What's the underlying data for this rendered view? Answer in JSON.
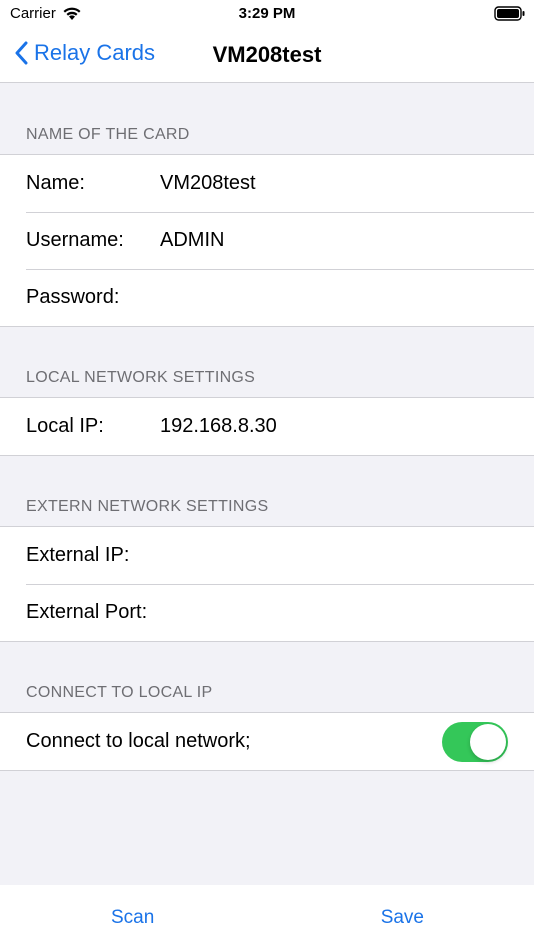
{
  "status_bar": {
    "carrier": "Carrier",
    "time": "3:29 PM"
  },
  "nav": {
    "back_label": "Relay Cards",
    "title": "VM208test"
  },
  "sections": {
    "card_name": {
      "header": "NAME OF THE CARD",
      "name_label": "Name:",
      "name_value": "VM208test",
      "username_label": "Username:",
      "username_value": "ADMIN",
      "password_label": "Password:",
      "password_value": ""
    },
    "local_network": {
      "header": "LOCAL NETWORK SETTINGS",
      "local_ip_label": "Local IP:",
      "local_ip_value": "192.168.8.30"
    },
    "extern_network": {
      "header": "EXTERN NETWORK SETTINGS",
      "external_ip_label": "External IP:",
      "external_ip_value": "",
      "external_port_label": "External Port:",
      "external_port_value": ""
    },
    "connect": {
      "header": "CONNECT TO LOCAL IP",
      "connect_label": "Connect to local network;",
      "connect_enabled": true
    }
  },
  "toolbar": {
    "scan_label": "Scan",
    "save_label": "Save"
  },
  "colors": {
    "accent": "#1a73e8",
    "toggle_on": "#34c759",
    "background": "#f2f2f7"
  }
}
